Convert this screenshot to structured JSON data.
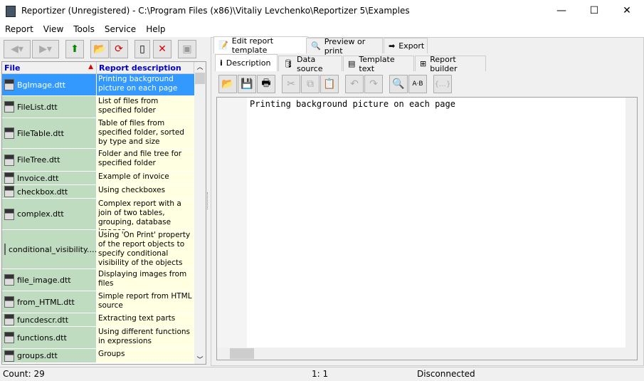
{
  "window": {
    "title": "Reportizer (Unregistered) - C:\\Program Files (x86)\\Vitaliy Levchenko\\Reportizer 5\\Examples",
    "min": "—",
    "max": "☐",
    "close": "✕"
  },
  "menu": [
    "Report",
    "View",
    "Tools",
    "Service",
    "Help"
  ],
  "grid": {
    "col_file": "File",
    "col_desc": "Report description",
    "sort_icon": "▲",
    "rows": [
      {
        "file": "BgImage.dtt",
        "desc": "Printing background picture on each page",
        "h": 31,
        "sel": true
      },
      {
        "file": "FileList.dtt",
        "desc": "List of files from specified folder",
        "h": 31
      },
      {
        "file": "FileTable.dtt",
        "desc": "Table of files from specified folder, sorted by type and size",
        "h": 43
      },
      {
        "file": "FileTree.dtt",
        "desc": "Folder and file tree for specified folder",
        "h": 32
      },
      {
        "file": "Invoice.dtt",
        "desc": "Example of invoice",
        "h": 19
      },
      {
        "file": "checkbox.dtt",
        "desc": "Using checkboxes",
        "h": 19
      },
      {
        "file": "complex.dtt",
        "desc": "Complex report with a join of two tables, grouping, database images",
        "h": 44
      },
      {
        "file": "conditional_visibility.…",
        "desc": "Using 'On Print' property of the report objects to specify conditional visibility of the objects",
        "h": 55
      },
      {
        "file": "file_image.dtt",
        "desc": "Displaying images from files",
        "h": 31
      },
      {
        "file": "from_HTML.dtt",
        "desc": "Simple report from HTML source",
        "h": 31
      },
      {
        "file": "funcdescr.dtt",
        "desc": "Extracting text parts",
        "h": 19
      },
      {
        "file": "functions.dtt",
        "desc": "Using different functions in expressions",
        "h": 31
      },
      {
        "file": "groups.dtt",
        "desc": "Groups",
        "h": 20
      }
    ]
  },
  "tabs": [
    "Edit report template",
    "Preview or print",
    "Export"
  ],
  "subtabs": [
    "Description",
    "Data source",
    "Template text",
    "Report builder"
  ],
  "editor_text": "Printing background picture on each page",
  "status": {
    "count": "Count: 29",
    "pos": "1:   1",
    "conn": "Disconnected"
  }
}
